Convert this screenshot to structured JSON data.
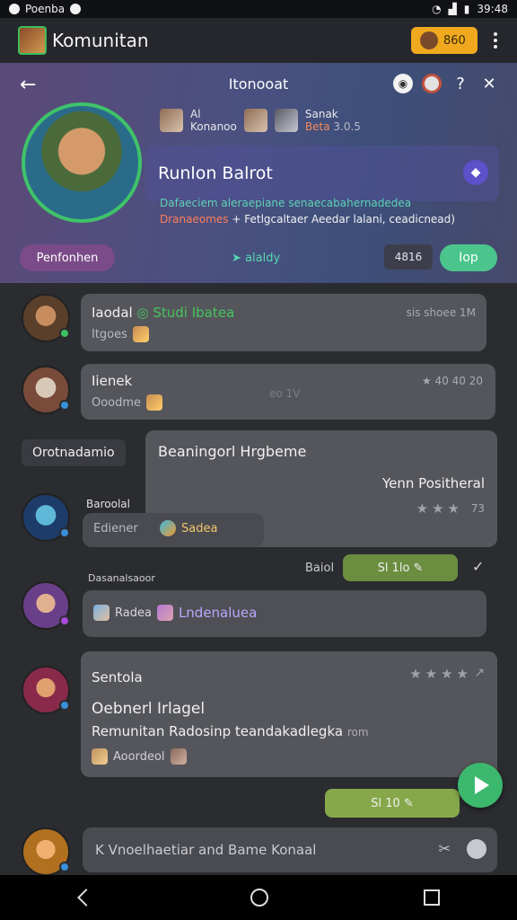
{
  "status_bar": {
    "app_label": "Poenba",
    "time": "39:48",
    "icons": [
      "wifi-icon",
      "signal-icon",
      "battery-icon"
    ]
  },
  "app_bar": {
    "title": "Komunitan",
    "coins": "860"
  },
  "hero": {
    "title": "Itonooat",
    "mini_user": {
      "line1": "Al",
      "line2": "Konanoo"
    },
    "mini_user2": {
      "line1": "Sanak",
      "line2_orange": "Beta",
      "line2": "3.0.5"
    },
    "name": "Runlon Balrot",
    "info_line1": "Dafaeciem aleraepiane senaecabahernadedea",
    "info_line2_orange": "Dranaeomes",
    "info_line2": "+ Fetlgcaltaer Aeedar lalani, ceadicnead)",
    "btn_left": "Penfonhen",
    "link_center": "alaldy",
    "btn_count": "4816",
    "btn_right": "Iop"
  },
  "feed": {
    "post1": {
      "name": "Iaodal",
      "status": "Studi Ibatea",
      "meta": "sis shoee 1M",
      "sub": "Itgoes"
    },
    "post2": {
      "name": "Iienek",
      "meta": "★ 40 40 20",
      "sub": "Ooodme",
      "mid": "eo 1V"
    },
    "tag_label": "Orotnadamio",
    "post3": {
      "name": "Baroolal",
      "sub": "Ediener",
      "title": "Beaningorl Hrgbeme",
      "right": "Yenn Positheral",
      "rating": "73",
      "game": "Sadea"
    },
    "action_row1": {
      "left": "Baiol",
      "right": "Sl 1lo"
    },
    "post4": {
      "header": "Dasanalsaoor",
      "sub1": "Radea",
      "sub2": "Lndenaluea"
    },
    "post5": {
      "name": "Sentola",
      "title": "Oebnerl Irlagel",
      "body": "Remunitan Radosinp teandakadlegka",
      "body_small": "rom",
      "footer": "Aoordeol"
    },
    "action_row2": {
      "right": "Sl 10"
    },
    "input_placeholder": "K Vnoelhaetiar and Bame Konaal"
  }
}
